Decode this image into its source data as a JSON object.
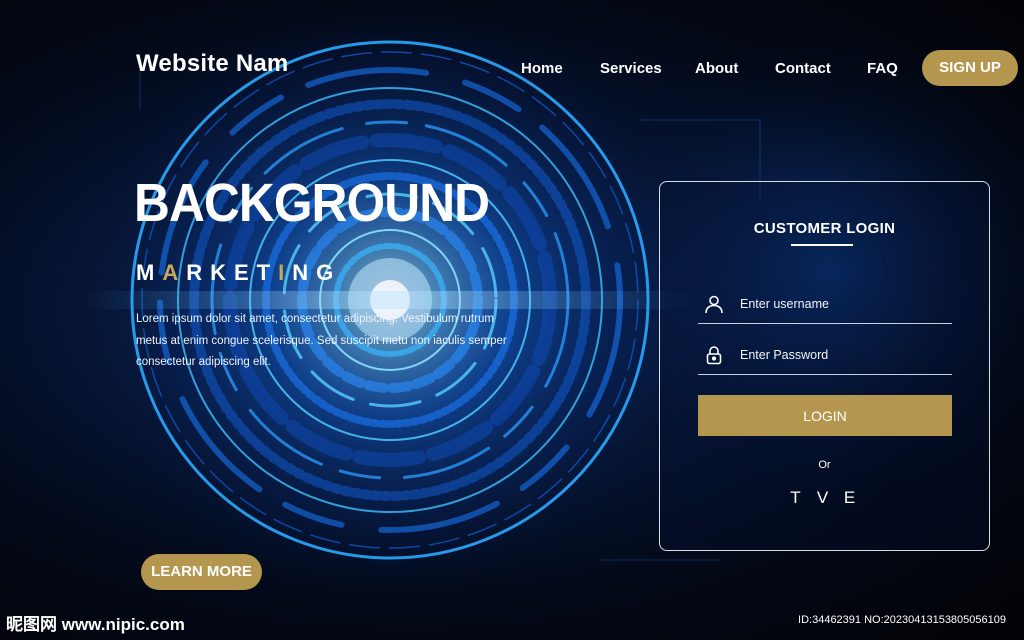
{
  "site": {
    "name": "Website Nam"
  },
  "nav": {
    "home": "Home",
    "services": "Services",
    "about": "About",
    "contact": "Contact",
    "faq": "FAQ",
    "signup": "SIGN UP"
  },
  "hero": {
    "title": "BACKGROUND",
    "subtitle_parts": [
      "M",
      "A",
      "RKET",
      "I",
      "NG"
    ],
    "text": "Lorem ipsum dolor sit amet, consectetur adipiscing. Vestibulum rutrum metus at enim congue scelerisque. Sed suscipit metu non iaculis semper consectetur adipiscing elit.",
    "cta": "LEARN MORE"
  },
  "login": {
    "title": "CUSTOMER LOGIN",
    "username_placeholder": "Enter username",
    "password_placeholder": "Enter Password",
    "button": "LOGIN",
    "or": "Or",
    "social": [
      "T",
      "V",
      "E"
    ]
  },
  "watermark": {
    "left": "昵图网 www.nipic.com",
    "right": "ID:34462391 NO:20230413153805056109"
  },
  "colors": {
    "accent_gold": "#b5964e",
    "text_gold": "#c8a85a",
    "background": "#02040c",
    "glow_blue": "#1f8bff"
  },
  "icons": {
    "username": "user-icon",
    "password": "lock-icon"
  }
}
